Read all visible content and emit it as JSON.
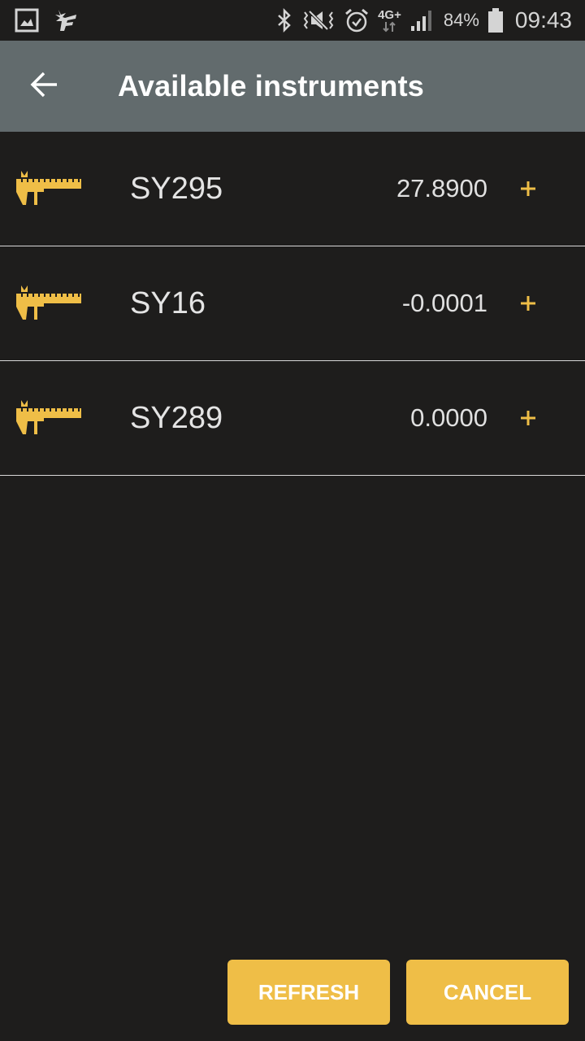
{
  "status_bar": {
    "left_icons": [
      "gallery-icon",
      "app-notification-icon"
    ],
    "right_icons": [
      "bluetooth-icon",
      "vibrate-mute-icon",
      "alarm-icon",
      "network-4g-plus-icon",
      "signal-icon"
    ],
    "network_label": "4G+",
    "battery_percent": "84%",
    "time": "09:43"
  },
  "app_bar": {
    "back_icon": "arrow-back-icon",
    "title": "Available instruments"
  },
  "instruments": [
    {
      "name": "SY295",
      "value": "27.8900",
      "icon": "caliper-icon",
      "action_icon": "plus-icon"
    },
    {
      "name": "SY16",
      "value": "-0.0001",
      "icon": "caliper-icon",
      "action_icon": "plus-icon"
    },
    {
      "name": "SY289",
      "value": "0.0000",
      "icon": "caliper-icon",
      "action_icon": "plus-icon"
    }
  ],
  "buttons": {
    "refresh": "REFRESH",
    "cancel": "CANCEL"
  },
  "colors": {
    "accent": "#efbe47",
    "app_bar": "#626b6d",
    "background": "#1e1d1c",
    "divider": "#d8d8d8"
  }
}
